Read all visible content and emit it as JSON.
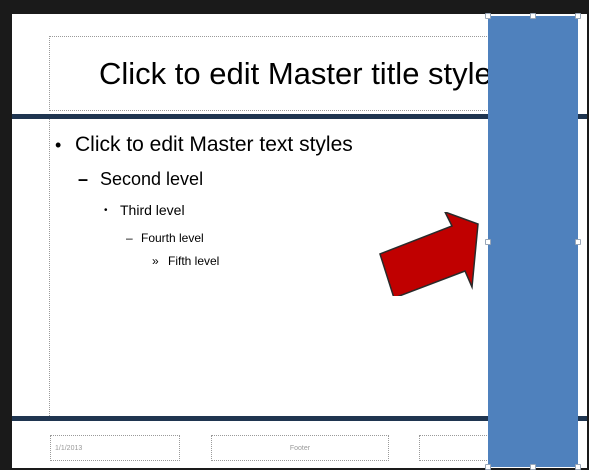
{
  "slide": {
    "title": "Click to edit Master title style",
    "body_levels": [
      {
        "bullet": "•",
        "text": "Click to edit Master text styles"
      },
      {
        "bullet": "–",
        "text": "Second level"
      },
      {
        "bullet": "•",
        "text": "Third level"
      },
      {
        "bullet": "–",
        "text": "Fourth level"
      },
      {
        "bullet": "»",
        "text": "Fifth level"
      }
    ],
    "footer": {
      "date": "1/1/2013",
      "center": "Footer",
      "number": ""
    }
  },
  "shapes": {
    "rectangle_color": "#4f81bd",
    "arrow_color": "#c00000",
    "arrow_icon": "right-arrow-icon"
  },
  "colors": {
    "frame": "#1a1a1a",
    "rule": "#1f3550"
  }
}
